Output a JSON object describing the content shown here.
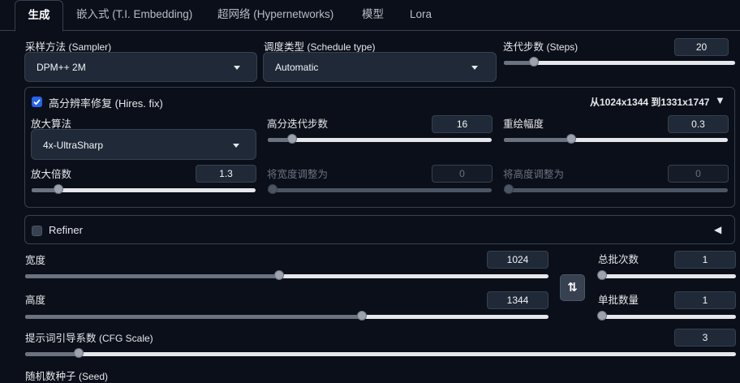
{
  "tabs": [
    {
      "label": "生成"
    },
    {
      "label": "嵌入式 (T.I. Embedding)"
    },
    {
      "label": "超网络 (Hypernetworks)"
    },
    {
      "label": "模型"
    },
    {
      "label": "Lora"
    }
  ],
  "sampler": {
    "label_cn": "采样方法",
    "label_en": "(Sampler)",
    "value": "DPM++ 2M"
  },
  "schedule": {
    "label_cn": "调度类型",
    "label_en": "(Schedule type)",
    "value": "Automatic"
  },
  "steps": {
    "label_cn": "迭代步数",
    "label_en": "(Steps)",
    "value": "20",
    "min": 1,
    "max": 150
  },
  "hires": {
    "label_cn": "高分辨率修复",
    "label_en": "(Hires. fix)",
    "checked": true,
    "resize_info": "从1024x1344 到1331x1747",
    "upscaler": {
      "label": "放大算法",
      "value": "4x-UltraSharp"
    },
    "hires_steps": {
      "label": "高分迭代步数",
      "value": "16",
      "min": 0,
      "max": 150
    },
    "denoise": {
      "label": "重绘幅度",
      "value": "0.3",
      "min": 0,
      "max": 1
    },
    "upscale_by": {
      "label": "放大倍数",
      "value": "1.3",
      "min": 1,
      "max": 4
    },
    "resize_width": {
      "label": "将宽度调整为",
      "value": "0"
    },
    "resize_height": {
      "label": "将高度调整为",
      "value": "0"
    }
  },
  "refiner": {
    "label": "Refiner",
    "checked": false
  },
  "width": {
    "label": "宽度",
    "value": "1024",
    "min": 64,
    "max": 2048
  },
  "height": {
    "label": "高度",
    "value": "1344",
    "min": 64,
    "max": 2048
  },
  "batch_count": {
    "label": "总批次数",
    "value": "1"
  },
  "batch_size": {
    "label": "单批数量",
    "value": "1"
  },
  "cfg": {
    "label_cn": "提示词引导系数",
    "label_en": "(CFG Scale)",
    "value": "3",
    "min": 1,
    "max": 30
  },
  "seed": {
    "label_cn": "随机数种子",
    "label_en": "(Seed)"
  },
  "icons": {
    "swap": "⇅",
    "expand": "▼",
    "collapse": "◀"
  },
  "colors": {
    "accent": "#2563eb",
    "background": "#0b0f19",
    "input": "#1f2937"
  }
}
